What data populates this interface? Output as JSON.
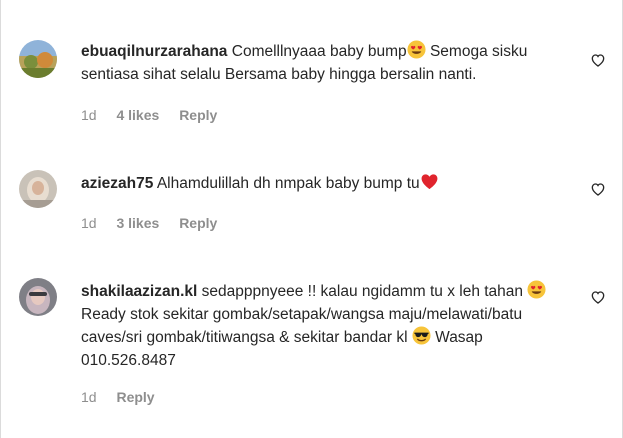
{
  "comments": [
    {
      "username": "ebuaqilnurzarahana",
      "text_parts": [
        "Comelllnyaaa baby bump",
        " Semoga sisku sentiasa sihat selalu Bersama baby hingga bersalin nanti."
      ],
      "emoji_after_part_1": "heart-eyes",
      "time": "1d",
      "likes": "4 likes",
      "reply": "Reply"
    },
    {
      "username": "aziezah75",
      "text_parts": [
        "Alhamdulillah dh nmpak baby bump tu"
      ],
      "emoji_after_part_1": "red-heart",
      "time": "1d",
      "likes": "3 likes",
      "reply": "Reply"
    },
    {
      "username": "shakilaazizan.kl",
      "text_parts": [
        "sedapppnyeee !! kalau ngidamm tu x leh tahan",
        " Ready stok sekitar gombak/setapak/wangsa maju/melawati/batu caves/sri gombak/titiwangsa & sekitar bandar kl",
        " Wasap 010.526.8487"
      ],
      "emoji_after_part_1": "heart-eyes",
      "emoji_after_part_2": "sunglasses",
      "time": "1d",
      "reply": "Reply"
    }
  ],
  "colors": {
    "text": "#262626",
    "meta": "#8e8e8e",
    "emoji_yellow": "#f7c43a",
    "heart_red": "#e0242d"
  },
  "icons": {
    "like": "heart-outline-icon"
  }
}
